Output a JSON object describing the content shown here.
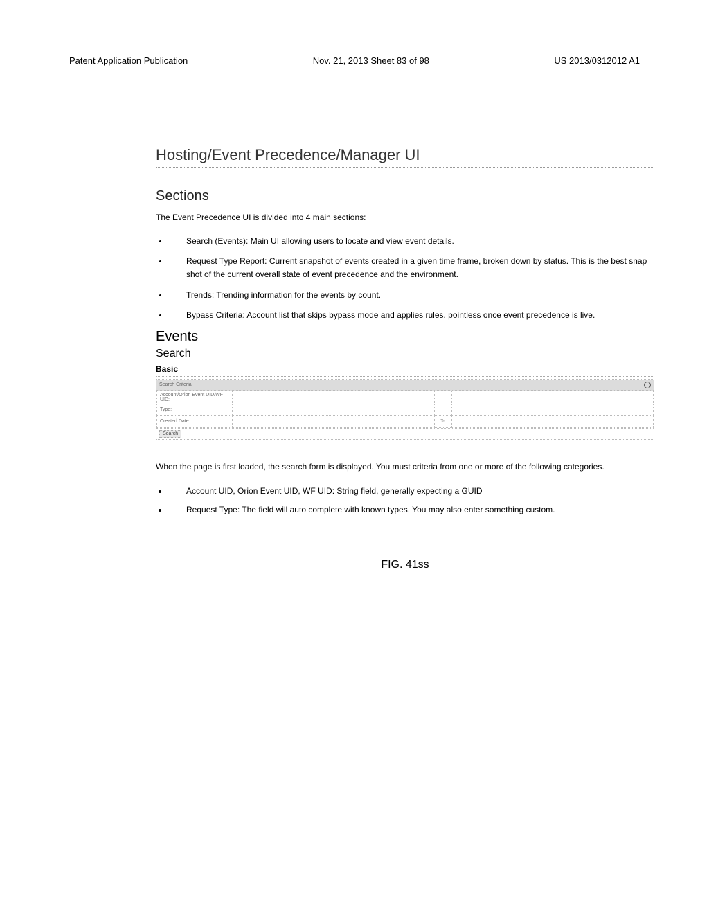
{
  "header": {
    "left": "Patent Application Publication",
    "mid": "Nov. 21, 2013  Sheet 83 of 98",
    "right": "US 2013/0312012 A1"
  },
  "title": "Hosting/Event Precedence/Manager UI",
  "sections_heading": "Sections",
  "sections_intro": "The Event Precedence UI is divided into 4 main sections:",
  "sections_list": [
    "Search (Events): Main UI allowing users to locate and view event details.",
    "Request Type Report: Current snapshot of events created in a given time frame, broken down by status. This is the best snap shot of the current overall state of event precedence and the environment.",
    "Trends: Trending information for the events by count.",
    "Bypass Criteria: Account list that skips bypass mode and applies rules. pointless once event precedence is live."
  ],
  "events_heading": "Events",
  "search_heading": "Search",
  "basic_heading": "Basic",
  "search_panel": {
    "title": "Search Criteria",
    "row1_label": "Account/Orion Event UID/WF UID:",
    "row2_label": "Type:",
    "row3_label": "Created Date:",
    "to": "To",
    "button": "Search"
  },
  "after_text": "When the page is first loaded, the search form is displayed. You must criteria from one or more of the following categories.",
  "after_list": [
    "Account UID, Orion Event UID, WF UID: String field, generally expecting a GUID",
    "Request Type: The field will auto complete with known types. You may also enter something custom."
  ],
  "figure_label": "FIG. 41ss"
}
